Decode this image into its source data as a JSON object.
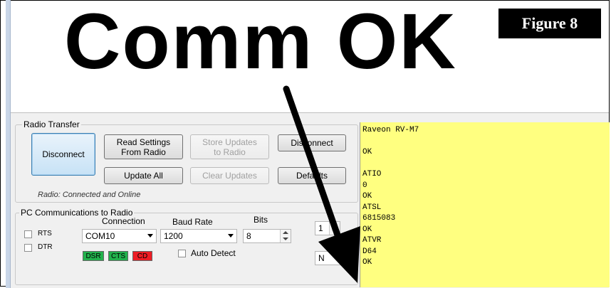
{
  "headline": "Comm OK",
  "figure_label": "Figure 8",
  "radio_transfer": {
    "title": "Radio Transfer",
    "disconnect_button": "Disconnect",
    "read_settings_button": "Read Settings\nFrom Radio",
    "store_updates_button": "Store Updates\nto Radio",
    "disconnect2_button": "Disconnect",
    "update_all_button": "Update All",
    "clear_updates_button": "Clear Updates",
    "defaults_button": "Defaults",
    "status": "Radio: Connected and Online"
  },
  "pc_comm": {
    "title": "PC Communications to Radio",
    "connection_label": "Connection",
    "baud_label": "Baud Rate",
    "bits_label": "Bits",
    "rts_label": "RTS",
    "dtr_label": "DTR",
    "connection_value": "COM10",
    "baud_value": "1200",
    "bits_value": "8",
    "stop_value": "1",
    "parity_value": "N",
    "auto_detect_label": "Auto Detect",
    "dsr_label": "DSR",
    "cts_label": "CTS",
    "cd_label": "CD"
  },
  "indicator_colors": {
    "dsr": "#22b14c",
    "cts": "#22b14c",
    "cd": "#ed1c24"
  },
  "terminal": {
    "background": "#ffff80",
    "lines": [
      "Raveon RV-M7",
      "",
      "OK",
      "",
      "ATIO",
      "0",
      "OK",
      "ATSL",
      "6815083",
      "OK",
      "ATVR",
      "D64",
      "OK"
    ]
  }
}
